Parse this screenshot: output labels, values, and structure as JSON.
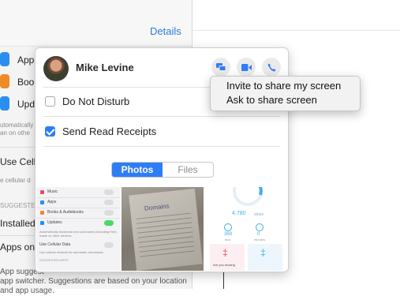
{
  "background_window": {
    "details_link": "Details",
    "settings_rows": [
      {
        "label": "Apps",
        "color": "#2a8ef0"
      },
      {
        "label": "Boo",
        "color": "#f08a24"
      },
      {
        "label": "Upd",
        "color": "#2a8ef0"
      }
    ],
    "note_lines": [
      "utomatically",
      "an on othe"
    ],
    "cellular_item": "Use Cellul",
    "cellular_note": "e cellular d",
    "suggested_caption": "SUGGESTED",
    "installed_item": "Installed A",
    "apps_on_item": "Apps on th",
    "footer_lines": [
      "App suggest",
      "app switcher. Suggestions are based on your location",
      "and app usage."
    ]
  },
  "popover": {
    "contact_name": "Mike Levine",
    "action_icons": [
      "screen-share-icon",
      "video-camera-icon",
      "phone-icon"
    ],
    "accent_color": "#2f7df6",
    "do_not_disturb": {
      "label": "Do Not Disturb",
      "checked": false
    },
    "read_receipts": {
      "label": "Send Read Receipts",
      "checked": true
    },
    "segmented": {
      "photos": "Photos",
      "files": "Files",
      "selected": "Photos"
    },
    "thumb1": {
      "rows": [
        {
          "label": "Music",
          "on": false
        },
        {
          "label": "Apps",
          "on": false
        },
        {
          "label": "Books & Audiobooks",
          "on": false
        },
        {
          "label": "Updates",
          "on": true
        }
      ],
      "note": "Automatically download new purchases (including free) made on other devices.",
      "cellular": "Use Cellular Data",
      "cellular_note": "Use cellular network for automatic downloads.",
      "suggested": "SUGGESTED APPS"
    },
    "thumb2": {
      "title": "Domains"
    },
    "thumb3": {
      "steps": "4,780",
      "steps_unit": "steps",
      "stat1": "369",
      "stat1_unit": "kcal",
      "stat2": "0",
      "stat2_unit": "minutes",
      "caption": "Are you moving"
    }
  },
  "context_menu": {
    "items": [
      "Invite to share my screen",
      "Ask to share screen"
    ]
  }
}
